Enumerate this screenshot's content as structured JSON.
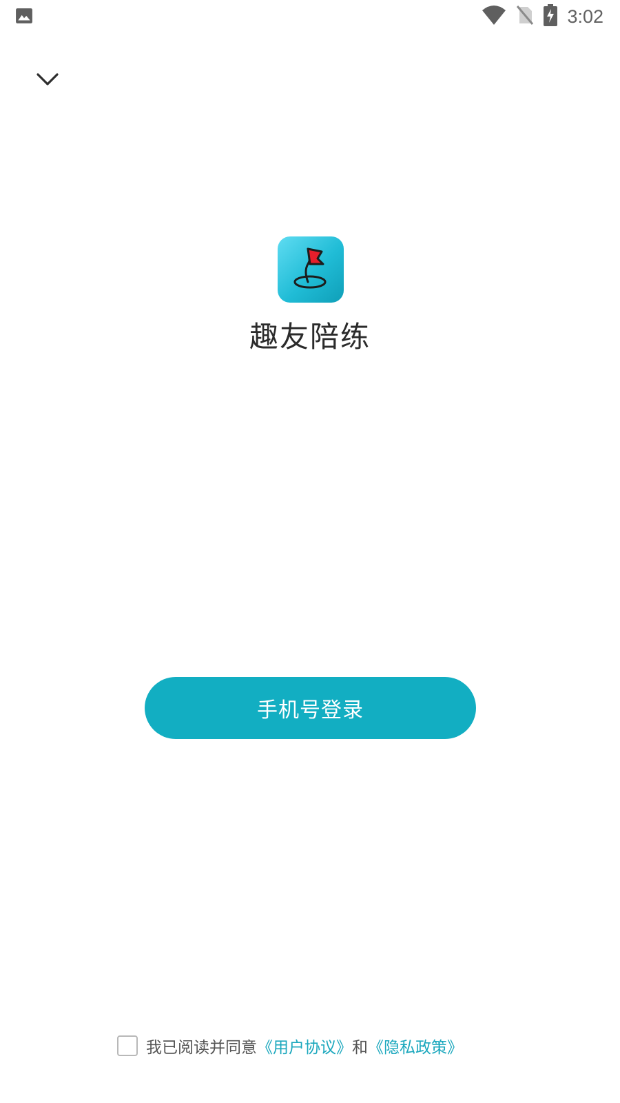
{
  "status_bar": {
    "time": "3:02",
    "icons": [
      "image-icon",
      "wifi-icon",
      "no-sim-icon",
      "battery-charging-icon"
    ]
  },
  "header": {
    "collapse_icon": "chevron-down-icon"
  },
  "app": {
    "name": "趣友陪练",
    "logo_icon": "flag-on-pin-icon"
  },
  "login": {
    "phone_login_label": "手机号登录"
  },
  "agreement": {
    "checked": false,
    "prefix": "我已阅读并同意",
    "user_agreement": "《用户协议》",
    "conjunction": "和",
    "privacy_policy": "《隐私政策》"
  },
  "colors": {
    "accent": "#12aec2",
    "link": "#1aa7bd",
    "logo_gradient_start": "#5fdcf2",
    "logo_gradient_end": "#0f9fb8"
  }
}
